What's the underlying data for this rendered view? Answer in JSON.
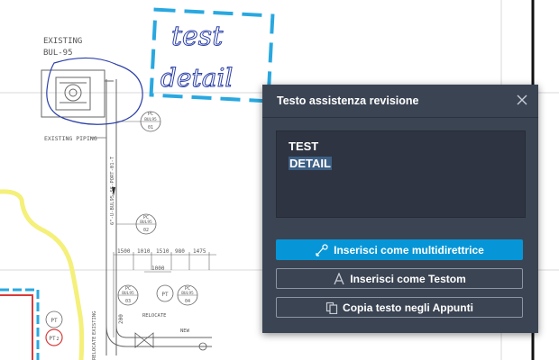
{
  "drawing": {
    "existing_label": "EXISTING",
    "support_label": "BUL-95",
    "existing_piping_label": "EXISTING PIPING",
    "pipe_label": "6\"-U-BUL95-SS-PORT-01-T",
    "tags": [
      {
        "top": "PC",
        "mid": "BUL95",
        "bot": "01"
      },
      {
        "top": "PC",
        "mid": "BUL95",
        "bot": "02"
      },
      {
        "top": "PC",
        "mid": "BUL95",
        "bot": "03"
      },
      {
        "top": "PC",
        "mid": "BUL95",
        "bot": "04"
      }
    ],
    "pt_label": "PT",
    "instrument_labels": [
      "PT",
      "PT",
      "2"
    ],
    "dimensions": [
      "1500",
      "1010",
      "1510",
      "980",
      "1475"
    ],
    "dimension_1000": "1000",
    "dim_200": "200",
    "relocate_labels": [
      "RELOCATE",
      "RELOCATE"
    ],
    "new_label": "NEW",
    "existing_vertical": "EXISTING",
    "markup_handwriting": [
      "test",
      "detail"
    ]
  },
  "dialog": {
    "title": "Testo assistenza revisione",
    "recognized_text": [
      "TEST",
      "DETAIL"
    ],
    "buttons": {
      "leader": "Inserisci come multidirettrice",
      "mtext": "Inserisci come Testom",
      "copy": "Copia testo negli Appunti"
    }
  },
  "colors": {
    "dialog_bg": "#3b4453",
    "primary_button": "#0696d7",
    "markup_cyan": "#29a8e0",
    "markup_blue": "#2b3fa8",
    "markup_yellow": "#f4f07a",
    "markup_red": "#d93a3a"
  }
}
